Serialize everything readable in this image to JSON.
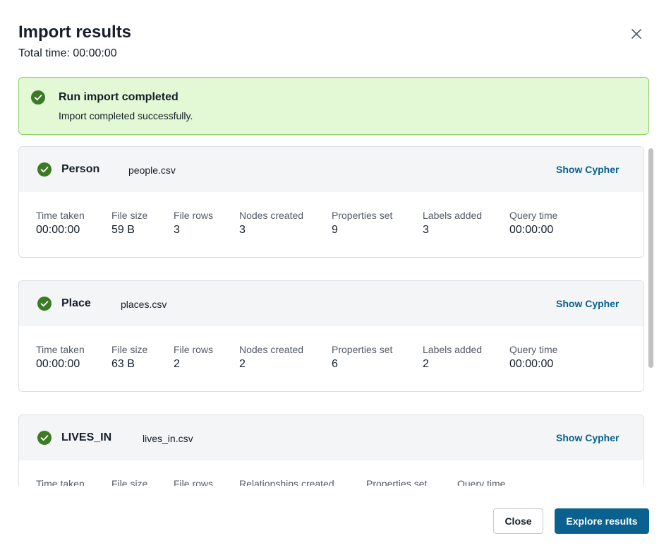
{
  "dialog": {
    "title": "Import results",
    "total_time": "Total time: 00:00:00",
    "close_icon": "close-icon"
  },
  "banner": {
    "icon": "check-circle-icon",
    "title": "Run import completed",
    "message": "Import completed successfully.",
    "background": "#e3f9d5",
    "border": "#8ed16a"
  },
  "colors": {
    "success": "#3d7a26",
    "accent": "#0a6190"
  },
  "results": [
    {
      "name": "Person",
      "file": "people.csv",
      "action": "Show Cypher",
      "stats": [
        {
          "label": "Time taken",
          "value": "00:00:00"
        },
        {
          "label": "File size",
          "value": "59 B"
        },
        {
          "label": "File rows",
          "value": "3"
        },
        {
          "label": "Nodes created",
          "value": "3"
        },
        {
          "label": "Properties set",
          "value": "9"
        },
        {
          "label": "Labels added",
          "value": "3"
        },
        {
          "label": "Query time",
          "value": "00:00:00"
        }
      ]
    },
    {
      "name": "Place",
      "file": "places.csv",
      "action": "Show Cypher",
      "stats": [
        {
          "label": "Time taken",
          "value": "00:00:00"
        },
        {
          "label": "File size",
          "value": "63 B"
        },
        {
          "label": "File rows",
          "value": "2"
        },
        {
          "label": "Nodes created",
          "value": "2"
        },
        {
          "label": "Properties set",
          "value": "6"
        },
        {
          "label": "Labels added",
          "value": "2"
        },
        {
          "label": "Query time",
          "value": "00:00:00"
        }
      ]
    },
    {
      "name": "LIVES_IN",
      "file": "lives_in.csv",
      "action": "Show Cypher",
      "stats": [
        {
          "label": "Time taken"
        },
        {
          "label": "File size"
        },
        {
          "label": "File rows"
        },
        {
          "label": "Relationships created"
        },
        {
          "label": "Properties set"
        },
        {
          "label": "Query time"
        }
      ]
    }
  ],
  "footer": {
    "close_label": "Close",
    "explore_label": "Explore results"
  }
}
